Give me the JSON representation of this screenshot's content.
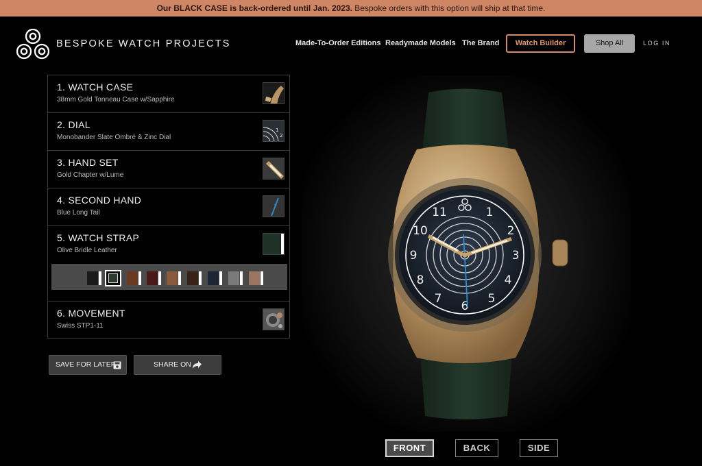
{
  "banner": {
    "bold": "Our BLACK CASE is back-ordered until Jan. 2023.",
    "rest": " Bespoke orders with this option will ship at that time."
  },
  "header": {
    "brand": "BESPOKE WATCH PROJECTS",
    "nav": [
      "Made-To-Order Editions",
      "Readymade Models",
      "The Brand"
    ],
    "builder": "Watch Builder",
    "shop": "Shop All",
    "login": "LOG IN"
  },
  "steps": [
    {
      "title": "1. WATCH CASE",
      "sub": "38mm Gold Tonneau Case w/Sapphire"
    },
    {
      "title": "2. DIAL",
      "sub": "Monobander Slate Ombré & Zinc Dial"
    },
    {
      "title": "3. HAND SET",
      "sub": "Gold Chapter w/Lume"
    },
    {
      "title": "4. SECOND HAND",
      "sub": "Blue Long Tail"
    },
    {
      "title": "5. WATCH STRAP",
      "sub": "Olive Bridle Leather"
    },
    {
      "title": "6. MOVEMENT",
      "sub": "Swiss STP1-11"
    }
  ],
  "strap_colors": [
    "#1a1a1a",
    "#2c3a2f",
    "#6b3a22",
    "#4a1a18",
    "#8a5a3e",
    "#3a2218",
    "#1e2636",
    "#7a7a7a",
    "#9a7560"
  ],
  "selected_strap_index": 1,
  "actions": {
    "save": "SAVE FOR LATER",
    "share": "SHARE ON"
  },
  "views": {
    "front": "FRONT",
    "back": "BACK",
    "side": "SIDE"
  },
  "dial_numerals": [
    "11",
    "1",
    "2",
    "3",
    "4",
    "5",
    "6",
    "7",
    "8",
    "9",
    "10"
  ],
  "colors": {
    "accent": "#d48b6a",
    "strap": "#1f3227",
    "gold": "#b99565",
    "dial": "#1c2531",
    "second_hand": "#2a8fd0"
  }
}
